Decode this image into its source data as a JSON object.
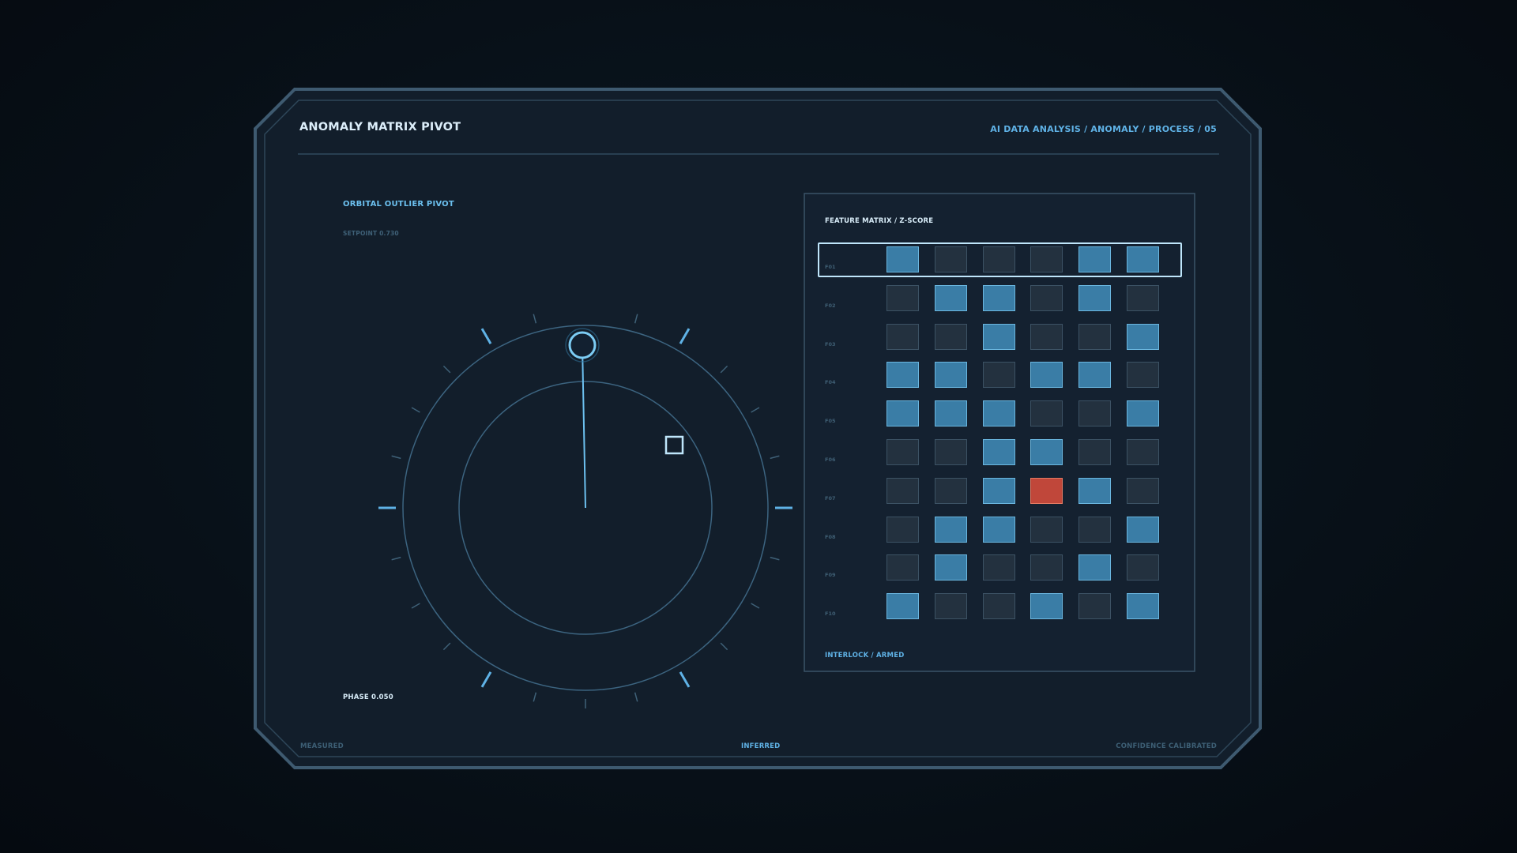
{
  "header": {
    "title": "ANOMALY MATRIX PIVOT",
    "breadcrumb": "AI DATA ANALYSIS / ANOMALY / PROCESS / 05"
  },
  "dial": {
    "title": "ORBITAL OUTLIER PIVOT",
    "setpoint": "SETPOINT 0.730",
    "phase": "PHASE 0.050",
    "needle_angle_deg": 1
  },
  "matrix": {
    "title": "FEATURE MATRIX / Z-SCORE",
    "status": "INTERLOCK / ARMED",
    "selected_row": "F01",
    "rows": [
      {
        "label": "F01",
        "cells": [
          "high",
          "low",
          "low",
          "low",
          "high",
          "high"
        ]
      },
      {
        "label": "F02",
        "cells": [
          "low",
          "high",
          "high",
          "low",
          "high",
          "low"
        ]
      },
      {
        "label": "F03",
        "cells": [
          "low",
          "low",
          "high",
          "low",
          "low",
          "high"
        ]
      },
      {
        "label": "F04",
        "cells": [
          "high",
          "high",
          "low",
          "high",
          "high",
          "low"
        ]
      },
      {
        "label": "F05",
        "cells": [
          "high",
          "high",
          "high",
          "low",
          "low",
          "high"
        ]
      },
      {
        "label": "F06",
        "cells": [
          "low",
          "low",
          "high",
          "high",
          "low",
          "low"
        ]
      },
      {
        "label": "F07",
        "cells": [
          "low",
          "low",
          "high",
          "anomaly",
          "high",
          "low"
        ]
      },
      {
        "label": "F08",
        "cells": [
          "low",
          "high",
          "high",
          "low",
          "low",
          "high"
        ]
      },
      {
        "label": "F09",
        "cells": [
          "low",
          "high",
          "low",
          "low",
          "high",
          "low"
        ]
      },
      {
        "label": "F10",
        "cells": [
          "high",
          "low",
          "low",
          "high",
          "low",
          "high"
        ]
      }
    ]
  },
  "footer": {
    "left": "MEASURED",
    "center": "INFERRED",
    "right": "CONFIDENCE CALIBRATED"
  },
  "colors": {
    "accent": "#5fb2e6",
    "cell_high": "#3a7da6",
    "cell_low": "#23313f",
    "anomaly": "#c0473a",
    "panel": "#121e2b"
  }
}
